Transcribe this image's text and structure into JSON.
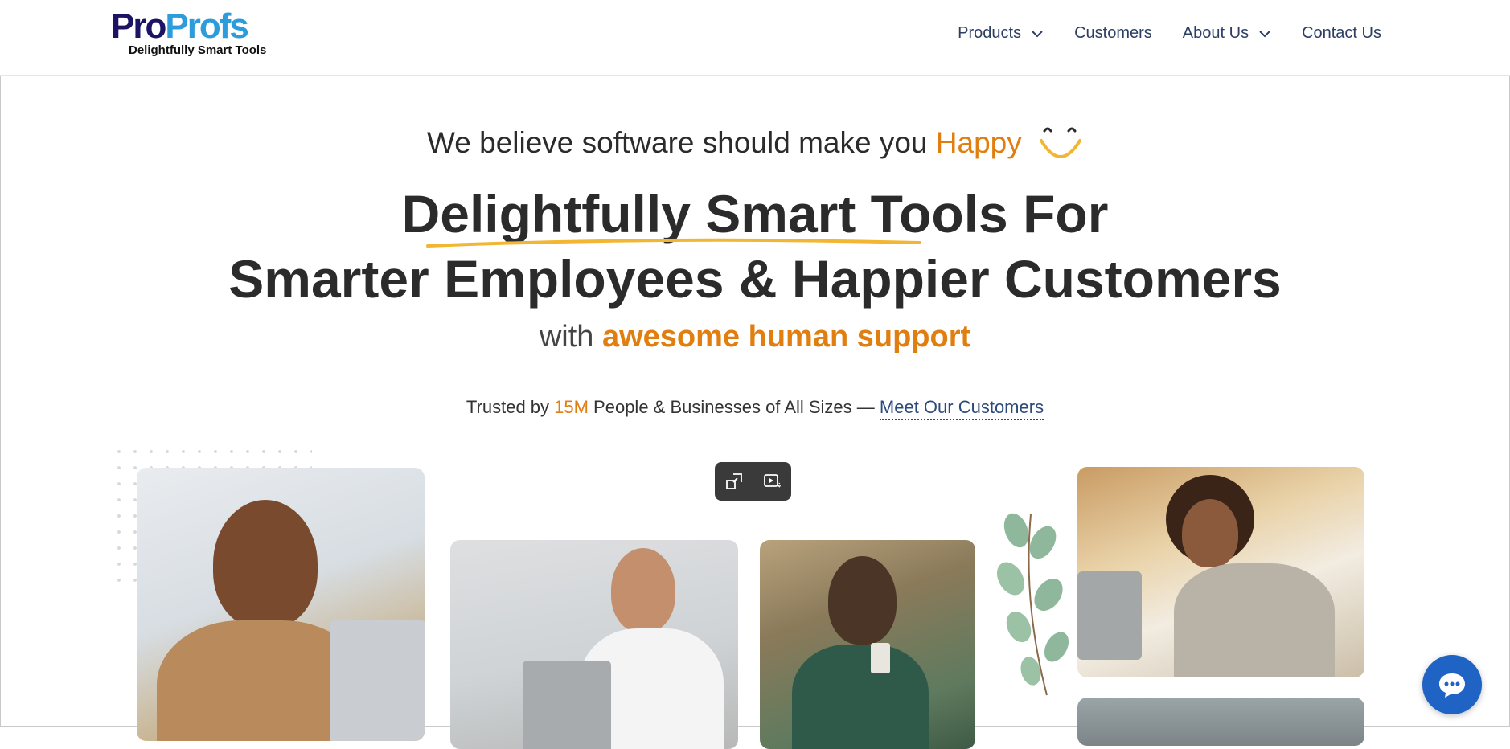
{
  "brand": {
    "logo_pro": "Pro",
    "logo_profs": "Profs",
    "tagline": "Delightfully Smart Tools",
    "colors": {
      "navy": "#1b1464",
      "blue": "#2d9cdb",
      "orange": "#e07e10",
      "nav_text": "#2c3e63"
    }
  },
  "nav": {
    "items": [
      {
        "label": "Products",
        "has_dropdown": true
      },
      {
        "label": "Customers",
        "has_dropdown": false
      },
      {
        "label": "About Us",
        "has_dropdown": true
      },
      {
        "label": "Contact Us",
        "has_dropdown": false
      }
    ]
  },
  "hero": {
    "belief_prefix": "We believe software should make you ",
    "belief_highlight": "Happy",
    "headline_line1": "Delightfully Smart Tools For",
    "headline_line2": "Smarter Employees & Happier Customers",
    "support_prefix": "with ",
    "support_highlight": "awesome human support",
    "trusted_prefix": "Trusted by ",
    "trusted_number": "15M",
    "trusted_suffix": " People & Businesses of All Sizes — ",
    "trusted_link": "Meet Our Customers"
  },
  "icons": {
    "chevron": "chevron-down-icon",
    "smile": "smile-icon",
    "exit_fullscreen": "exit-fullscreen-icon",
    "video_magic": "video-magic-icon",
    "chat": "chat-bubble-icon"
  }
}
